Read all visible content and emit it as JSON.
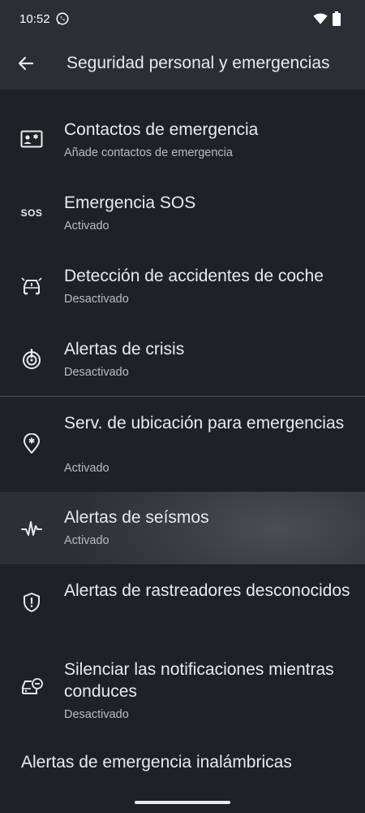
{
  "status_bar": {
    "time": "10:52",
    "icons": [
      "whatsapp-icon",
      "wifi-icon",
      "battery-icon"
    ]
  },
  "app_bar": {
    "title": "Seguridad personal y emergencias",
    "back_icon": "arrow-back-icon"
  },
  "items": [
    {
      "icon": "contact-card-icon",
      "title": "Contactos de emergencia",
      "summary": "Añade contactos de emergencia"
    },
    {
      "icon": "sos-icon",
      "icon_text": "SOS",
      "title": "Emergencia SOS",
      "summary": "Activado"
    },
    {
      "icon": "car-crash-icon",
      "title": "Detección de accidentes de coche",
      "summary": "Desactivado"
    },
    {
      "icon": "crisis-alert-icon",
      "title": "Alertas de crisis",
      "summary": "Desactivado"
    },
    {
      "icon": "emergency-location-icon",
      "title": "Serv. de ubicación para emergencias",
      "summary": "Activado"
    },
    {
      "icon": "earthquake-icon",
      "title": "Alertas de seísmos",
      "summary": "Activado",
      "highlighted": true
    },
    {
      "icon": "shield-alert-icon",
      "title": "Alertas de rastreadores desconocidos",
      "summary": ""
    },
    {
      "icon": "driving-mode-icon",
      "title": "Silenciar las notificaciones mientras conduces",
      "summary": "Desactivado"
    }
  ],
  "wireless_alerts": {
    "title": "Alertas de emergencia inalámbricas"
  },
  "colors": {
    "background": "#1f2124",
    "bar": "#2b2e32",
    "text": "#e8eaed",
    "summary": "#b9bcc1"
  }
}
